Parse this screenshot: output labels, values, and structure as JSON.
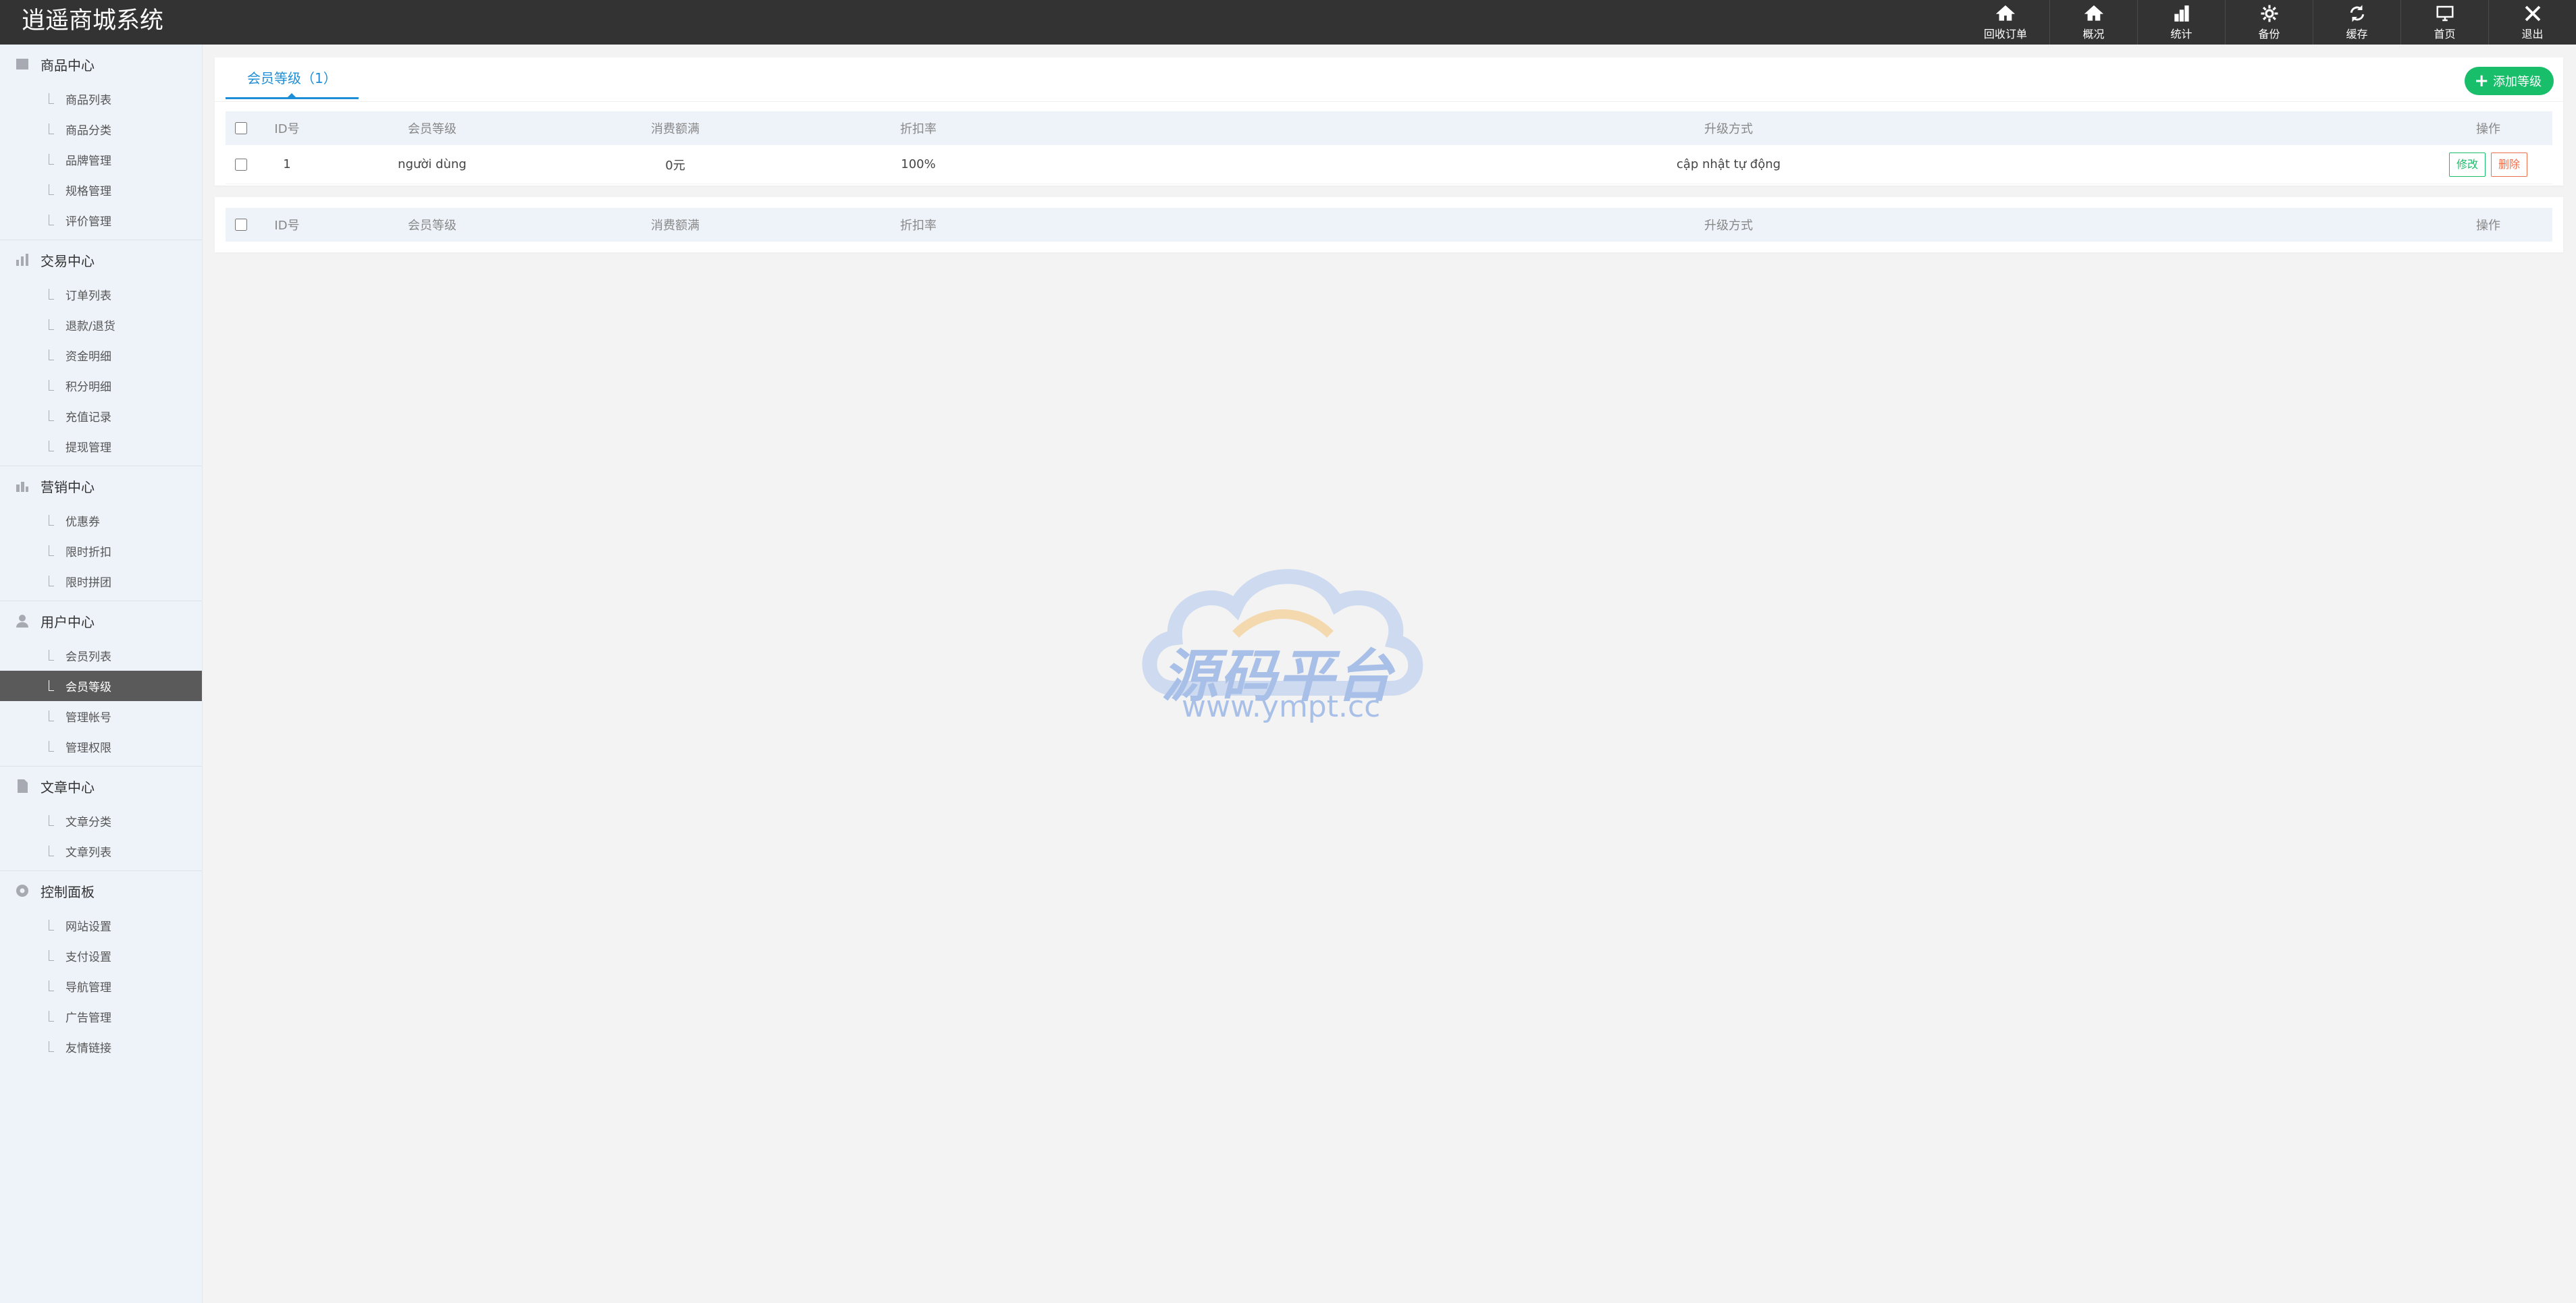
{
  "app": {
    "title": "逍遥商城系统"
  },
  "top_nav": [
    {
      "label": "回收订单",
      "icon": "home-icon"
    },
    {
      "label": "概况",
      "icon": "home-icon"
    },
    {
      "label": "统计",
      "icon": "bar-chart-icon"
    },
    {
      "label": "备份",
      "icon": "gear-icon"
    },
    {
      "label": "缓存",
      "icon": "refresh-icon"
    },
    {
      "label": "首页",
      "icon": "monitor-icon"
    },
    {
      "label": "退出",
      "icon": "close-icon"
    }
  ],
  "sidebar": {
    "groups": [
      {
        "title": "商品中心",
        "icon": "box-icon",
        "items": [
          "商品列表",
          "商品分类",
          "品牌管理",
          "规格管理",
          "评价管理"
        ]
      },
      {
        "title": "交易中心",
        "icon": "bar-chart-icon",
        "items": [
          "订单列表",
          "退款/退货",
          "资金明细",
          "积分明细",
          "充值记录",
          "提现管理"
        ]
      },
      {
        "title": "营销中心",
        "icon": "chart-icon",
        "items": [
          "优惠券",
          "限时折扣",
          "限时拼团"
        ]
      },
      {
        "title": "用户中心",
        "icon": "user-icon",
        "items": [
          "会员列表",
          "会员等级",
          "管理帐号",
          "管理权限"
        ]
      },
      {
        "title": "文章中心",
        "icon": "document-icon",
        "items": [
          "文章分类",
          "文章列表"
        ]
      },
      {
        "title": "控制面板",
        "icon": "gear-icon",
        "items": [
          "网站设置",
          "支付设置",
          "导航管理",
          "广告管理",
          "友情链接"
        ]
      }
    ],
    "active_item": "会员等级"
  },
  "main": {
    "tab_label": "会员等级（1）",
    "add_button": "添加等级",
    "columns": {
      "id": "ID号",
      "level": "会员等级",
      "spend": "消费额满",
      "discount": "折扣率",
      "upgrade": "升级方式",
      "ops": "操作"
    },
    "rows": [
      {
        "id": "1",
        "level": "người dùng",
        "spend": "0元",
        "discount": "100%",
        "upgrade": "cập nhật tự động",
        "edit": "修改",
        "delete": "删除"
      }
    ]
  },
  "watermark": {
    "text": "源码平台",
    "url": "www.ympt.cc"
  },
  "colors": {
    "topbar": "#333333",
    "accent": "#1e8fd6",
    "success": "#19be6b",
    "danger": "#ed6f4c",
    "sidebar_active": "#5a5a5a"
  }
}
